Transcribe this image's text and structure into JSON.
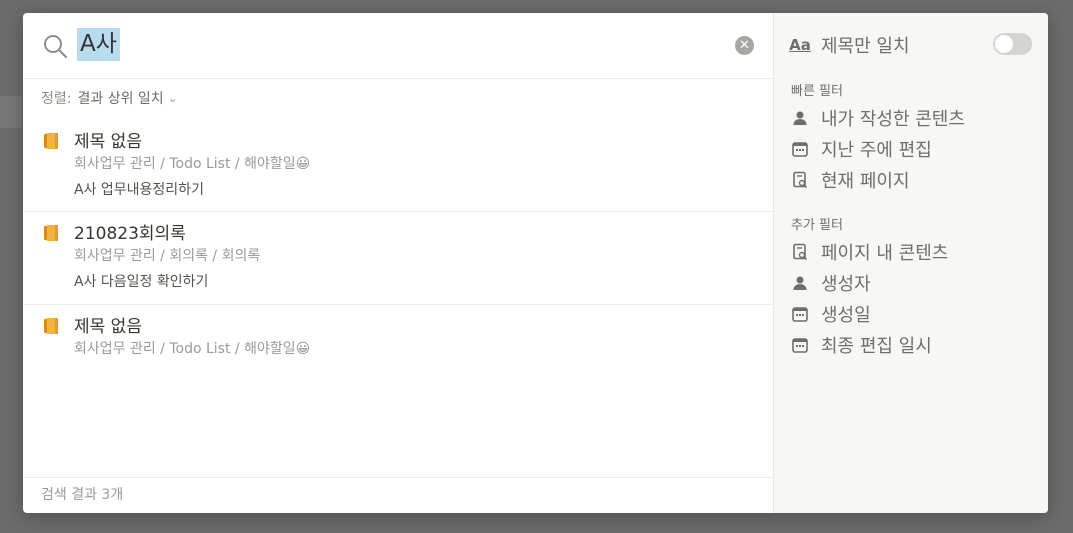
{
  "search": {
    "query": "A사"
  },
  "sort": {
    "label": "정렬:",
    "value": "결과 상위 일치"
  },
  "results": [
    {
      "title": "제목 없음",
      "path": "회사업무 관리 / Todo List / 해야할일😀",
      "snippet": "A사 업무내용정리하기"
    },
    {
      "title": "210823회의록",
      "path": "회사업무 관리 / 회의록 / 회의록",
      "snippet": "A사 다음일정 확인하기"
    },
    {
      "title": "제목 없음",
      "path": "회사업무 관리 / Todo List / 해야할일😀",
      "snippet": ""
    }
  ],
  "footer": {
    "count_text": "검색 결과 3개"
  },
  "filters": {
    "title_only": {
      "label": "제목만 일치",
      "icon_text": "Aa",
      "enabled": false
    },
    "quick_section": "빠른 필터",
    "quick": [
      {
        "label": "내가 작성한 콘텐츠",
        "icon": "person-icon"
      },
      {
        "label": "지난 주에 편집",
        "icon": "calendar-icon"
      },
      {
        "label": "현재 페이지",
        "icon": "page-search-icon"
      }
    ],
    "more_section": "추가 필터",
    "more": [
      {
        "label": "페이지 내 콘텐츠",
        "icon": "page-search-icon"
      },
      {
        "label": "생성자",
        "icon": "person-icon"
      },
      {
        "label": "생성일",
        "icon": "calendar-icon"
      },
      {
        "label": "최종 편집 일시",
        "icon": "calendar-icon"
      }
    ]
  },
  "colors": {
    "highlight": "#b7dcef",
    "text": "#37352f",
    "muted": "#9b9a97",
    "panel": "#f7f7f5"
  }
}
